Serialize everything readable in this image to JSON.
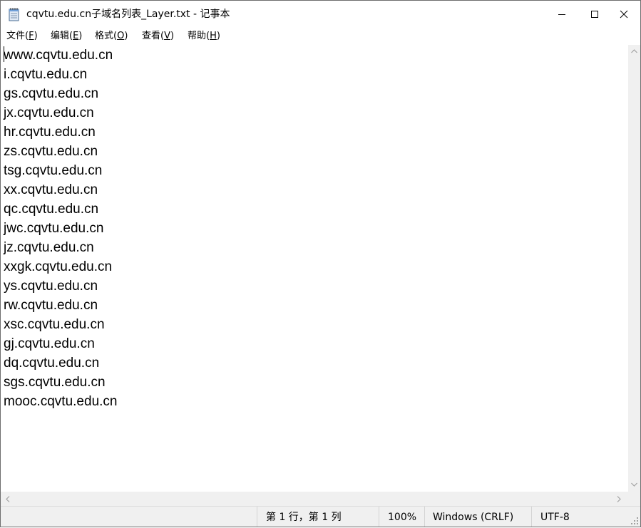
{
  "window": {
    "title": "cqvtu.edu.cn子域名列表_Layer.txt - 记事本",
    "icon": "notepad-icon",
    "controls": [
      "minimize-icon",
      "maximize-icon",
      "close-icon"
    ]
  },
  "menu": [
    {
      "label": "文件(",
      "key": "F",
      "end": ")"
    },
    {
      "label": "编辑(",
      "key": "E",
      "end": ")"
    },
    {
      "label": "格式(",
      "key": "O",
      "end": ")"
    },
    {
      "label": "查看(",
      "key": "V",
      "end": ")"
    },
    {
      "label": "帮助(",
      "key": "H",
      "end": ")"
    }
  ],
  "content": {
    "lines": [
      "www.cqvtu.edu.cn",
      "i.cqvtu.edu.cn",
      "gs.cqvtu.edu.cn",
      "jx.cqvtu.edu.cn",
      "hr.cqvtu.edu.cn",
      "zs.cqvtu.edu.cn",
      "tsg.cqvtu.edu.cn",
      "xx.cqvtu.edu.cn",
      "qc.cqvtu.edu.cn",
      "jwc.cqvtu.edu.cn",
      "jz.cqvtu.edu.cn",
      "xxgk.cqvtu.edu.cn",
      "ys.cqvtu.edu.cn",
      "rw.cqvtu.edu.cn",
      "xsc.cqvtu.edu.cn",
      "gj.cqvtu.edu.cn",
      "dq.cqvtu.edu.cn",
      "sgs.cqvtu.edu.cn",
      "mooc.cqvtu.edu.cn"
    ]
  },
  "status": {
    "position": "第 1 行，第 1 列",
    "zoom": "100%",
    "line_ending": "Windows (CRLF)",
    "encoding": "UTF-8"
  }
}
